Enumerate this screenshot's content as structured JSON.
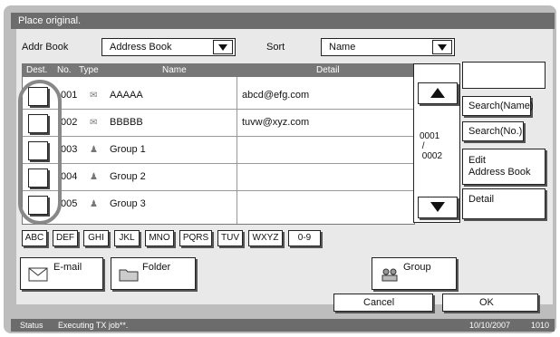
{
  "title": "Place original.",
  "addr_book": {
    "label": "Addr Book",
    "value": "Address Book"
  },
  "sort": {
    "label": "Sort",
    "value": "Name"
  },
  "list": {
    "headers": {
      "dest": "Dest.",
      "no": "No.",
      "type": "Type",
      "name": "Name",
      "detail": "Detail"
    },
    "rows": [
      {
        "no": "001",
        "type_icon": "email-icon",
        "name": "AAAAA",
        "detail": "abcd@efg.com"
      },
      {
        "no": "002",
        "type_icon": "email-icon",
        "name": "BBBBB",
        "detail": "tuvw@xyz.com"
      },
      {
        "no": "003",
        "type_icon": "group-icon",
        "name": "Group 1",
        "detail": ""
      },
      {
        "no": "004",
        "type_icon": "group-icon",
        "name": "Group 2",
        "detail": ""
      },
      {
        "no": "005",
        "type_icon": "group-icon",
        "name": "Group 3",
        "detail": ""
      }
    ]
  },
  "page_indicator": "0001\n /\n 0002",
  "right_buttons": {
    "search_name": "Search(Name)",
    "search_no": "Search(No.)",
    "edit_line1": "Edit",
    "edit_line2": "Address Book",
    "detail": "Detail"
  },
  "alpha_buttons": [
    "ABC",
    "DEF",
    "GHI",
    "JKL",
    "MNO",
    "PQRS",
    "TUV",
    "WXYZ",
    "0-9"
  ],
  "big_buttons": {
    "email": "E-mail",
    "folder": "Folder",
    "group": "Group"
  },
  "footer": {
    "cancel": "Cancel",
    "ok": "OK"
  },
  "status": {
    "label": "Status",
    "message": "Executing TX job**.",
    "datetime": "10/10/2007",
    "time": "1010"
  }
}
